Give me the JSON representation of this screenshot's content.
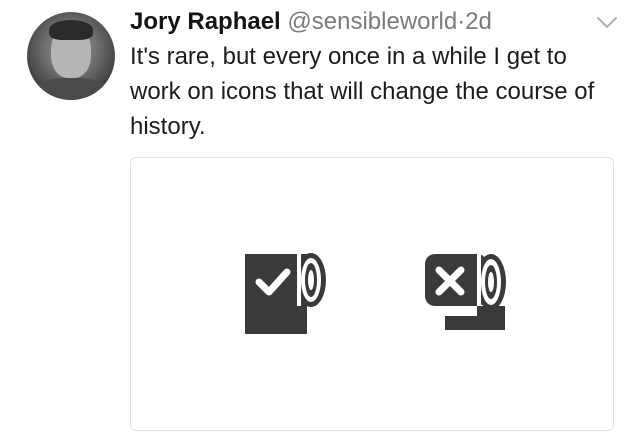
{
  "tweet": {
    "author_name": "Jory Raphael",
    "handle": "@sensibleworld",
    "separator": "·",
    "time": "2d",
    "text": "It's rare, but every once in a while I get to work on icons that will change the course of history."
  },
  "card": {
    "icons": [
      "toilet-paper-checkmark-icon",
      "toilet-paper-x-icon"
    ]
  },
  "colors": {
    "name": "#141414",
    "meta": "#7b7b7b",
    "icon": "#3a3a3a",
    "card_border": "#e3e3e3"
  }
}
